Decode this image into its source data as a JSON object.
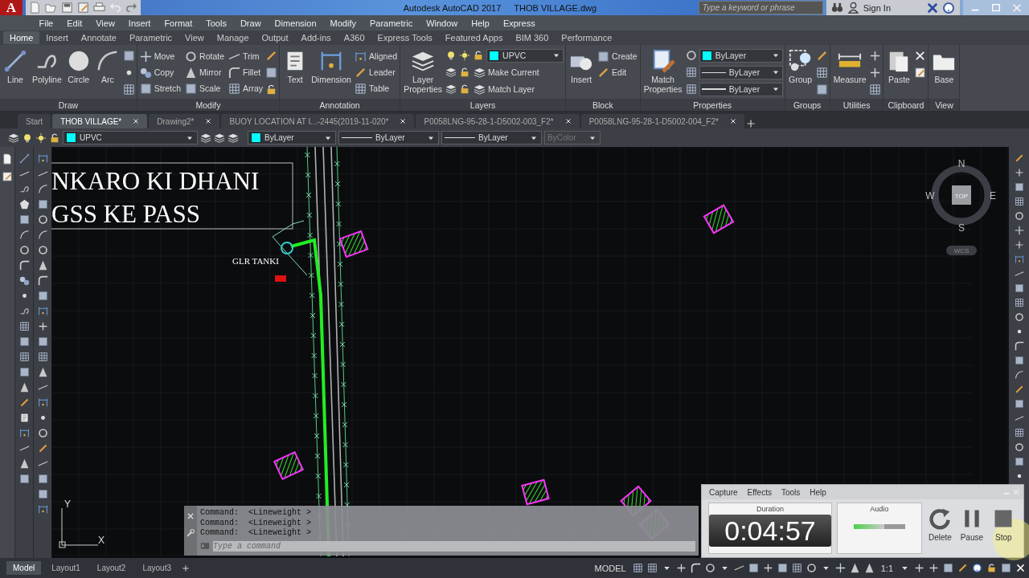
{
  "title_bar": {
    "app_letter": "A",
    "title": "Autodesk AutoCAD 2017",
    "file": "THOB VILLAGE.dwg",
    "search": {
      "placeholder": "Type a keyword or phrase"
    },
    "sign_in": "Sign In"
  },
  "menu_bar": [
    "File",
    "Edit",
    "View",
    "Insert",
    "Format",
    "Tools",
    "Draw",
    "Dimension",
    "Modify",
    "Parametric",
    "Window",
    "Help",
    "Express"
  ],
  "ribbon_tabs": [
    {
      "label": "Home",
      "selected": true
    },
    {
      "label": "Insert",
      "selected": false
    },
    {
      "label": "Annotate",
      "selected": false
    },
    {
      "label": "Parametric",
      "selected": false
    },
    {
      "label": "View",
      "selected": false
    },
    {
      "label": "Manage",
      "selected": false
    },
    {
      "label": "Output",
      "selected": false
    },
    {
      "label": "Add-ins",
      "selected": false
    },
    {
      "label": "A360",
      "selected": false
    },
    {
      "label": "Express Tools",
      "selected": false
    },
    {
      "label": "Featured Apps",
      "selected": false
    },
    {
      "label": "BIM 360",
      "selected": false
    },
    {
      "label": "Performance",
      "selected": false
    }
  ],
  "ribbon_panels": [
    {
      "title": "Draw",
      "large": [
        "Line",
        "Polyline",
        "Circle",
        "Arc"
      ]
    },
    {
      "title": "Modify",
      "small": [
        "Move",
        "Rotate",
        "Trim",
        "Copy",
        "Mirror",
        "Fillet",
        "Stretch",
        "Scale",
        "Array"
      ]
    },
    {
      "title": "Annotation",
      "large": [
        "Text",
        "Dimension"
      ],
      "small": [
        "Aligned",
        "Leader",
        "Table"
      ]
    },
    {
      "title": "Layers",
      "large": [
        "Layer Properties"
      ],
      "layer": {
        "name": "UPVC",
        "color": "#00ffff"
      },
      "small": [
        "Make Current",
        "Match Layer"
      ]
    },
    {
      "title": "Block",
      "large": [
        "Insert"
      ],
      "small": [
        "Create",
        "Edit"
      ]
    },
    {
      "title": "Properties",
      "large": [
        "Match Properties"
      ],
      "dropdowns": [
        {
          "kind": "color",
          "label": "ByLayer",
          "color": "#00ffff"
        },
        {
          "kind": "linetype",
          "label": "ByLayer"
        },
        {
          "kind": "lineweight",
          "label": "ByLayer"
        }
      ]
    },
    {
      "title": "Groups",
      "large": [
        "Group"
      ]
    },
    {
      "title": "Utilities",
      "large": [
        "Measure"
      ]
    },
    {
      "title": "Clipboard",
      "large": [
        "Paste"
      ]
    },
    {
      "title": "View",
      "large": [
        "Base"
      ]
    }
  ],
  "file_tabs": [
    {
      "label": "Start",
      "selected": false,
      "closable": false
    },
    {
      "label": "THOB VILLAGE*",
      "selected": true,
      "closable": true
    },
    {
      "label": "Drawing2*",
      "selected": false,
      "closable": true
    },
    {
      "label": "BUOY LOCATION AT I...-2445(2019-11-020*",
      "selected": false,
      "closable": true
    },
    {
      "label": "P0058LNG-95-28-1-D5002-003_F2*",
      "selected": false,
      "closable": true
    },
    {
      "label": "P0058LNG-95-28-1-D5002-004_F2*",
      "selected": false,
      "closable": true
    }
  ],
  "properties_bar": [
    {
      "kind": "layer",
      "label": "UPVC",
      "color": "#00ffff",
      "disabled": false
    },
    {
      "kind": "color",
      "label": "ByLayer",
      "color": "#00ffff",
      "disabled": false
    },
    {
      "kind": "linetype",
      "label": "ByLayer",
      "disabled": false
    },
    {
      "kind": "lineweight",
      "label": "ByLayer",
      "disabled": false
    },
    {
      "kind": "plotstyle",
      "label": "ByColor",
      "disabled": true
    }
  ],
  "canvas": {
    "heading": [
      "NKARO KI DHANI",
      "GSS KE PASS"
    ],
    "tank_label": "GLR TANKI",
    "compass": {
      "north": "N",
      "south": "S",
      "east": "E",
      "west": "W",
      "top": "TOP",
      "wcs": "WCS"
    },
    "axes": {
      "x": "X",
      "y": "Y"
    }
  },
  "command_line": {
    "history": [
      "Command:  <Lineweight >",
      "Command:  <Lineweight >",
      "Command:  <Lineweight >"
    ],
    "placeholder": "Type a command"
  },
  "layout_tabs": [
    {
      "label": "Model",
      "selected": true
    },
    {
      "label": "Layout1",
      "selected": false
    },
    {
      "label": "Layout2",
      "selected": false
    },
    {
      "label": "Layout3",
      "selected": false
    }
  ],
  "status_bar": {
    "space": "MODEL",
    "scale": "1:1"
  },
  "recorder": {
    "menu": [
      "Capture",
      "Effects",
      "Tools",
      "Help"
    ],
    "duration_label": "Duration",
    "duration": "0:04:57",
    "audio_label": "Audio",
    "audio": {
      "level": 0.6
    },
    "buttons": [
      "Delete",
      "Pause",
      "Stop"
    ]
  }
}
